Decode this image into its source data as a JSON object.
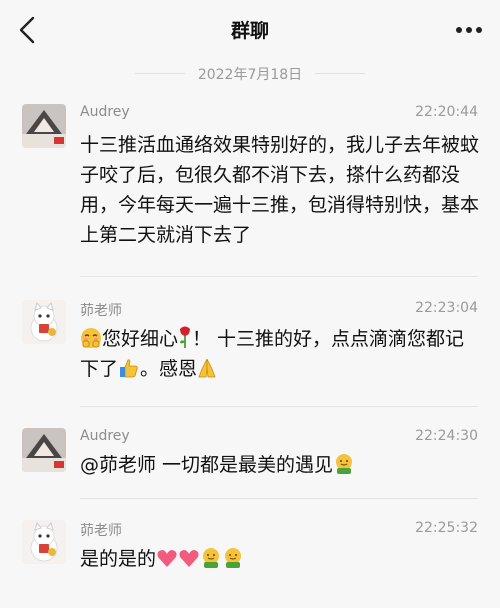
{
  "header": {
    "title": "群聊",
    "back_icon": "chevron-left-icon",
    "more_icon": "more-dots-icon"
  },
  "date_divider": "2022年7月18日",
  "messages": [
    {
      "sender": "Audrey",
      "time": "22:20:44",
      "text": "十三推活血通络效果特别好的，我儿子去年被蚊子咬了后，包很久都不消下去，搽什么药都没用，今年每天一遍十三推，包消得特别快，基本上第二天就消下去了",
      "avatar": "audrey-avatar"
    },
    {
      "sender": "茆老师",
      "time": "22:23:04",
      "text_parts": [
        "您好细心",
        "！ 十三推的好，点点滴滴您都记下了",
        "。感恩"
      ],
      "avatar": "teacher-cat-avatar"
    },
    {
      "sender": "Audrey",
      "time": "22:24:30",
      "text": "@茆老师 一切都是最美的遇见",
      "avatar": "audrey-avatar"
    },
    {
      "sender": "茆老师",
      "time": "22:25:32",
      "text": "是的是的",
      "avatar": "teacher-cat-avatar"
    }
  ],
  "colors": {
    "background": "#f7f7f7",
    "name": "#8c8c8c",
    "time": "#9a9a9a",
    "separator": "#e4e4e4"
  }
}
